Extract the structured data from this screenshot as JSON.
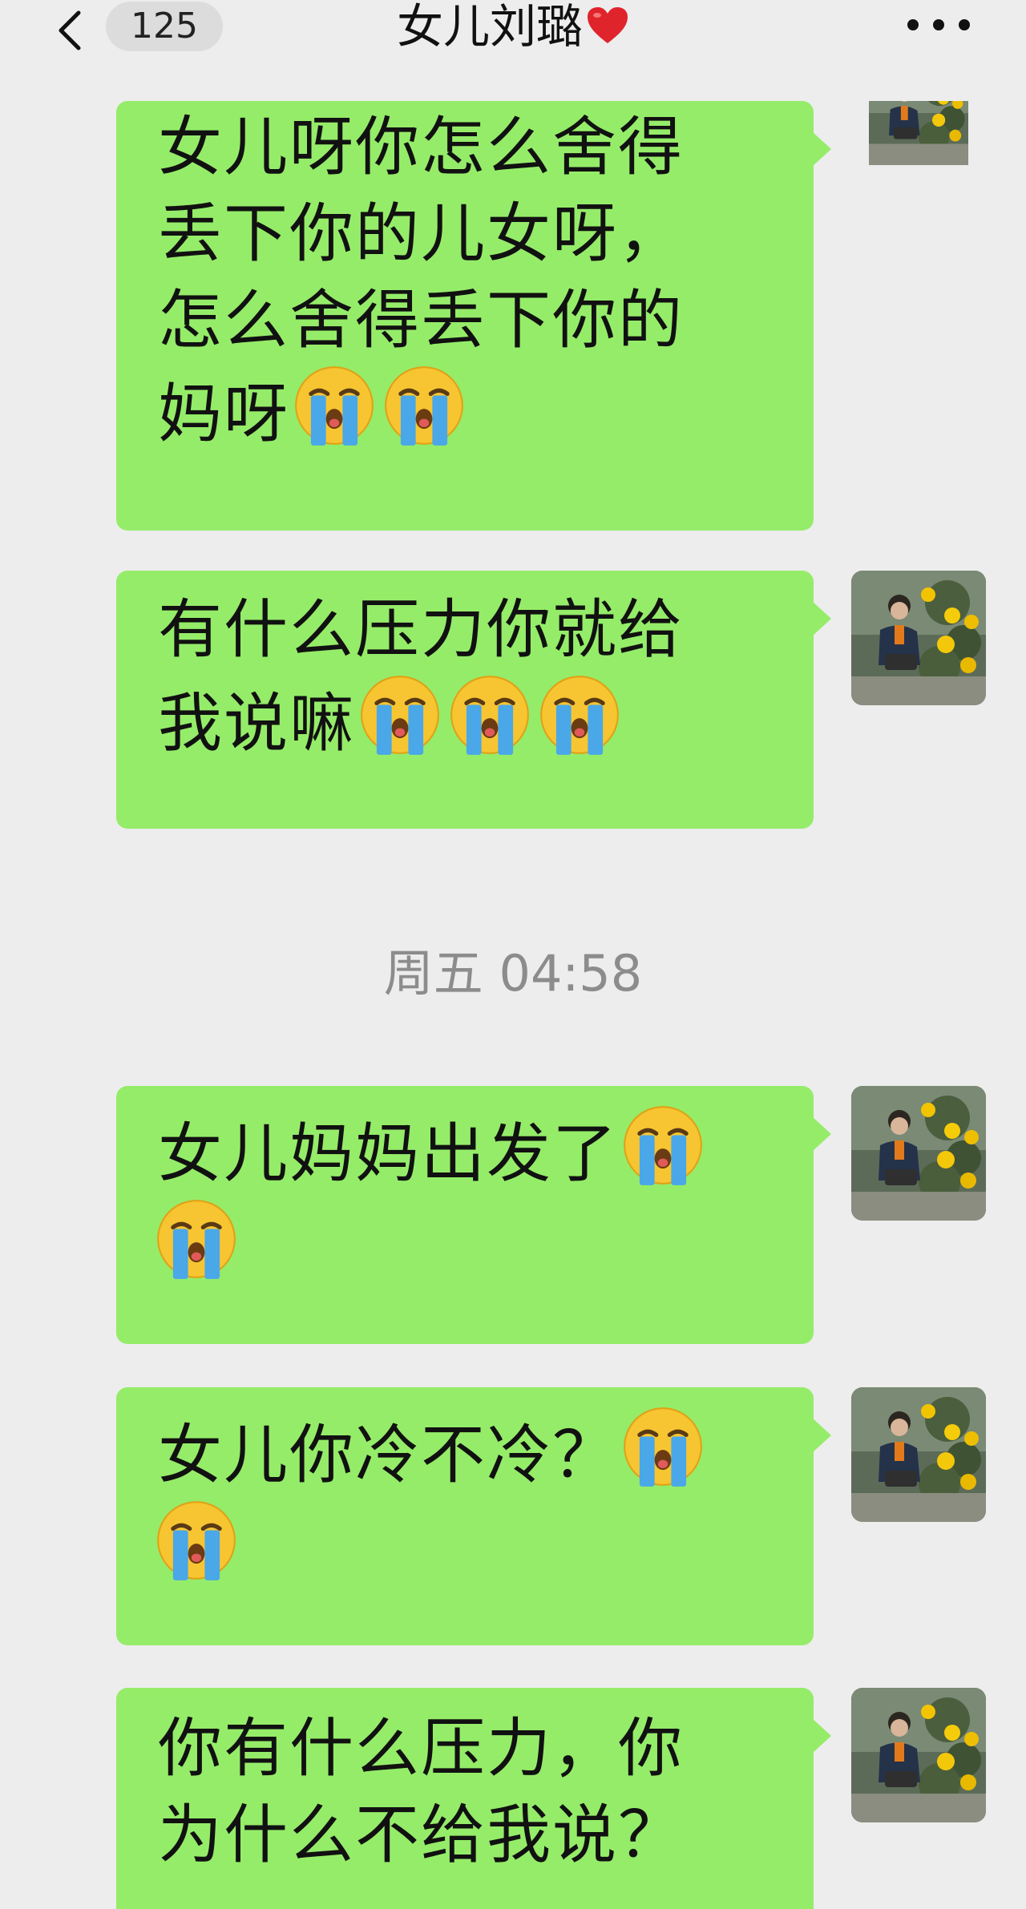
{
  "header": {
    "unread_count": "125",
    "contact_name": "女儿刘璐",
    "back_icon": "chevron-left-icon",
    "more_icon": "more-dots-icon",
    "heart_icon": "red-heart-emoji"
  },
  "colors": {
    "background": "#ededed",
    "bubble": "#95ec69",
    "timestamp_text": "#8c8c8c"
  },
  "timestamp": "周五 04:58",
  "messages": [
    {
      "lines": [
        "女儿呀你怎么舍得",
        "丢下你的儿女呀，",
        "怎么舍得丢下你的",
        "妈呀"
      ],
      "emoji_after_last_line": 2,
      "emoji": "loudly-crying-face"
    },
    {
      "lines": [
        "有什么压力你就给",
        "我说嘛"
      ],
      "emoji_after_last_line": 3,
      "emoji": "loudly-crying-face"
    },
    {
      "lines": [
        "女儿妈妈出发了"
      ],
      "emoji_after_last_line": 1,
      "second_line_emoji": 1,
      "emoji": "loudly-crying-face"
    },
    {
      "lines": [
        "女儿你冷不冷？"
      ],
      "emoji_after_last_line": 1,
      "second_line_emoji": 1,
      "emoji": "loudly-crying-face"
    },
    {
      "lines": [
        "你有什么压力，你",
        "为什么不给我说？"
      ],
      "emoji_after_last_line": 0,
      "emoji": "loudly-crying-face"
    }
  ]
}
